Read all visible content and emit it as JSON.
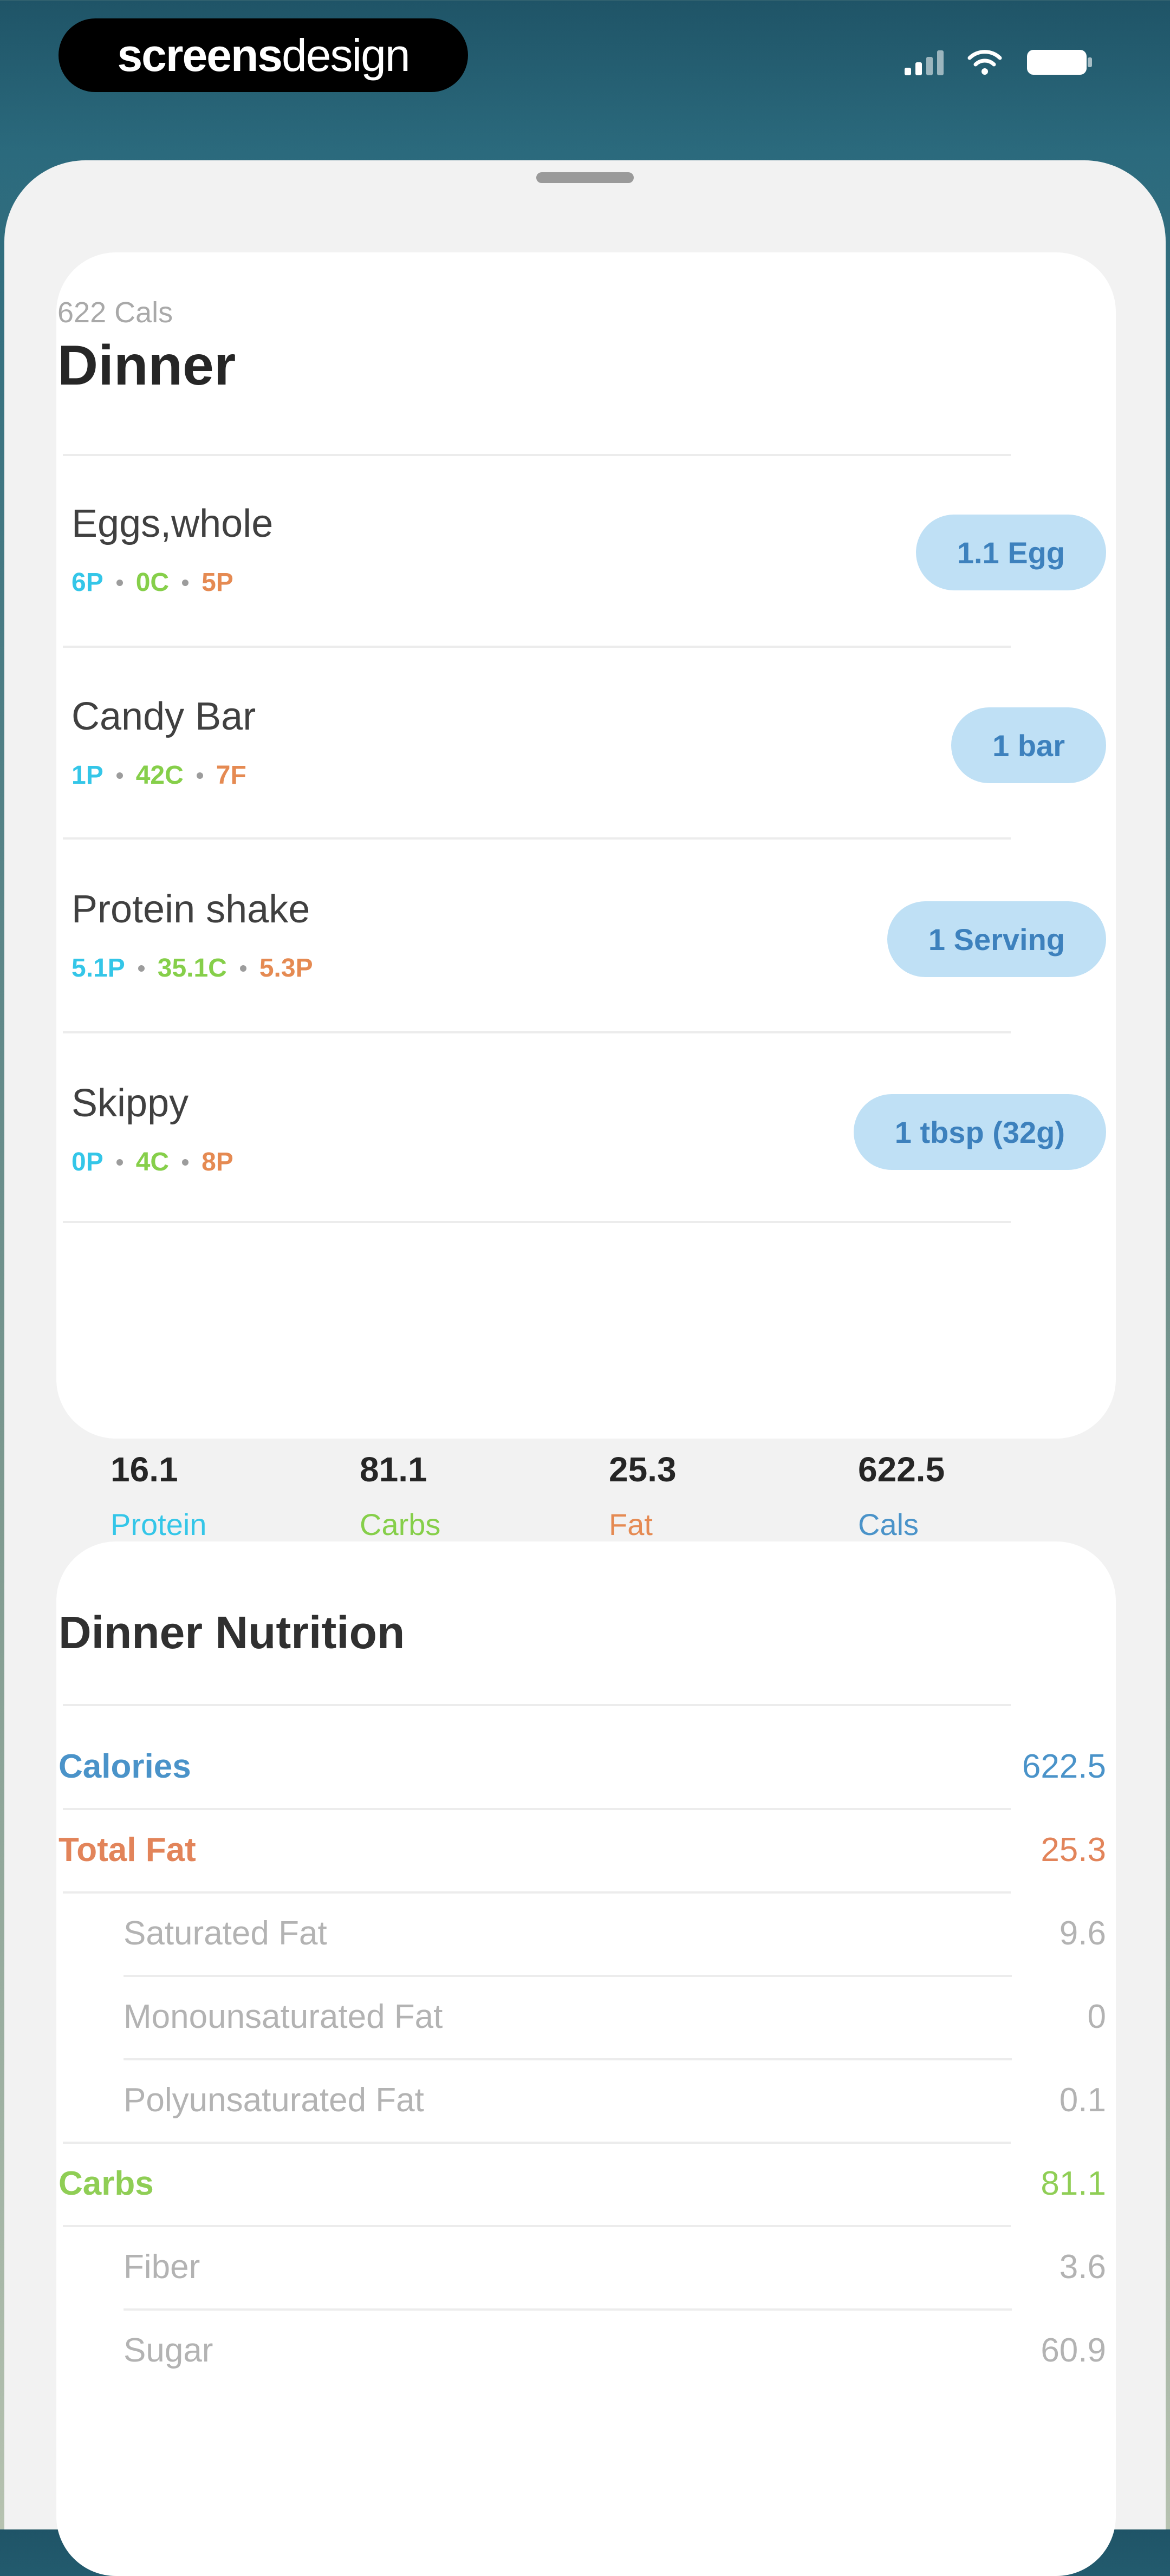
{
  "status_bar": {
    "watermark_bold": "screens",
    "watermark_light": "design",
    "icons": [
      "signal-icon",
      "wifi-icon",
      "battery-icon"
    ]
  },
  "meal": {
    "calories_label": "622 Cals",
    "title": "Dinner",
    "items": [
      {
        "name": "Eggs,whole",
        "protein": "6P",
        "carbs": "0C",
        "fat": "5P",
        "serving": "1.1 Egg"
      },
      {
        "name": "Candy Bar",
        "protein": "1P",
        "carbs": "42C",
        "fat": "7F",
        "serving": "1 bar"
      },
      {
        "name": "Protein shake",
        "protein": "5.1P",
        "carbs": "35.1C",
        "fat": "5.3P",
        "serving": "1 Serving"
      },
      {
        "name": "Skippy",
        "protein": "0P",
        "carbs": "4C",
        "fat": "8P",
        "serving": "1 tbsp (32g)"
      }
    ],
    "totals": [
      {
        "value": "16.1",
        "label": "Protein"
      },
      {
        "value": "81.1",
        "label": "Carbs"
      },
      {
        "value": "25.3",
        "label": "Fat"
      },
      {
        "value": "622.5",
        "label": "Cals"
      }
    ]
  },
  "nutrition": {
    "title": "Dinner Nutrition",
    "rows": [
      {
        "label": "Calories",
        "value": "622.5"
      },
      {
        "label": "Total Fat",
        "value": "25.3"
      },
      {
        "label": "Saturated Fat",
        "value": "9.6"
      },
      {
        "label": "Monounsaturated Fat",
        "value": "0"
      },
      {
        "label": "Polyunsaturated Fat",
        "value": "0.1"
      },
      {
        "label": "Carbs",
        "value": "81.1"
      },
      {
        "label": "Fiber",
        "value": "3.6"
      },
      {
        "label": "Sugar",
        "value": "60.9"
      }
    ]
  },
  "colors": {
    "protein": "#34c6e8",
    "carbs": "#86cf4a",
    "fat": "#e58a52",
    "calories": "#4a93c9",
    "pill_bg": "#bfe0f5",
    "pill_text": "#3d81bd"
  }
}
